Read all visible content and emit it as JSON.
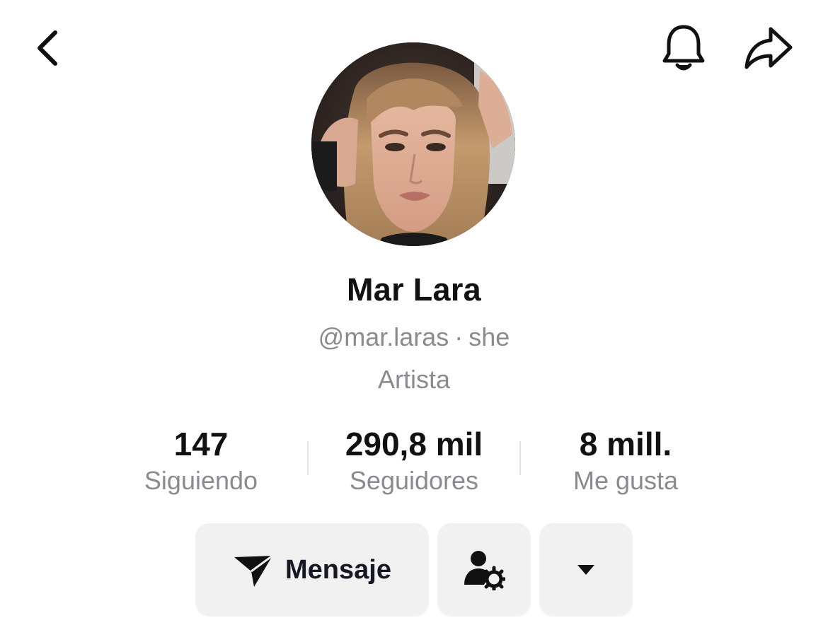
{
  "header": {
    "back_icon": "chevron-left-icon",
    "notification_icon": "bell-icon",
    "share_icon": "share-arrow-icon"
  },
  "profile": {
    "avatar": "profile-photo",
    "name": "Mar Lara",
    "username": "@mar.laras",
    "separator": "·",
    "pronouns": "she",
    "category": "Artista"
  },
  "stats": [
    {
      "value": "147",
      "label": "Siguiendo"
    },
    {
      "value": "290,8 mil",
      "label": "Seguidores"
    },
    {
      "value": "8 mill.",
      "label": "Me gusta"
    }
  ],
  "actions": {
    "message_label": "Mensaje",
    "message_icon": "send-icon",
    "friends_icon": "user-settings-icon",
    "more_icon": "caret-down-icon"
  }
}
